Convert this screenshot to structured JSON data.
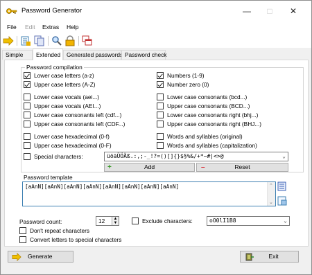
{
  "window": {
    "title": "Password Generator",
    "min_glyph": "—",
    "max_glyph": "□",
    "close_glyph": "✕"
  },
  "menu": [
    "File",
    "Edit",
    "Extras",
    "Help"
  ],
  "tabs": [
    "Simple",
    "Extended",
    "Generated passwords",
    "Password check"
  ],
  "active_tab": 1,
  "compilation": {
    "label": "Password compilation",
    "left": [
      {
        "label": "Lower case letters (a-z)",
        "checked": true
      },
      {
        "label": "Upper case letters (A-Z)",
        "checked": true
      },
      {
        "label": "Lower case vocals (aei...)",
        "checked": false
      },
      {
        "label": "Upper case vocals (AEI...)",
        "checked": false
      },
      {
        "label": "Lower case consonants left (cdf...)",
        "checked": false
      },
      {
        "label": "Upper case consonants left (CDF...)",
        "checked": false
      },
      {
        "label": "Lower case hexadecimal (0-f)",
        "checked": false
      },
      {
        "label": "Upper case hexadecimal (0-F)",
        "checked": false
      }
    ],
    "right": [
      {
        "label": "Numbers (1-9)",
        "checked": true
      },
      {
        "label": "Number zero (0)",
        "checked": true
      },
      {
        "label": "Lower case consonants (bcd...)",
        "checked": false
      },
      {
        "label": "Upper case consonants (BCD...)",
        "checked": false
      },
      {
        "label": "Lower case consonants right (bhj...)",
        "checked": false
      },
      {
        "label": "Upper case consonants right (BHJ...)",
        "checked": false
      },
      {
        "label": "Words and syllables (original)",
        "checked": false
      },
      {
        "label": "Words and syllables (capitalization)",
        "checked": false
      }
    ],
    "special": {
      "label": "Special characters:",
      "checked": false,
      "value": "üöäÜÖÄß.:,;-_!?=()[]{}$§%&/+*~#|<>@"
    },
    "add_label": "Add",
    "reset_label": "Reset",
    "add_glyph": "+",
    "reset_glyph": "–"
  },
  "template": {
    "label": "Password template",
    "value": "[aAnN][aAnN][aAnN][aAnN][aAnN][aAnN][aAnN][aAnN]"
  },
  "count": {
    "label": "Password count:",
    "value": "12"
  },
  "exclude": {
    "label": "Exclude characters:",
    "checked": false,
    "value": "oO0lI1B8"
  },
  "dont_repeat": {
    "label": "Don't repeat characters",
    "checked": false
  },
  "convert": {
    "label": "Convert letters to special characters",
    "checked": false
  },
  "generate_label": "Generate",
  "exit_label": "Exit",
  "colors": {
    "accent": "#3c7fb1",
    "green": "#3a9a2a",
    "red": "#d8202a"
  }
}
